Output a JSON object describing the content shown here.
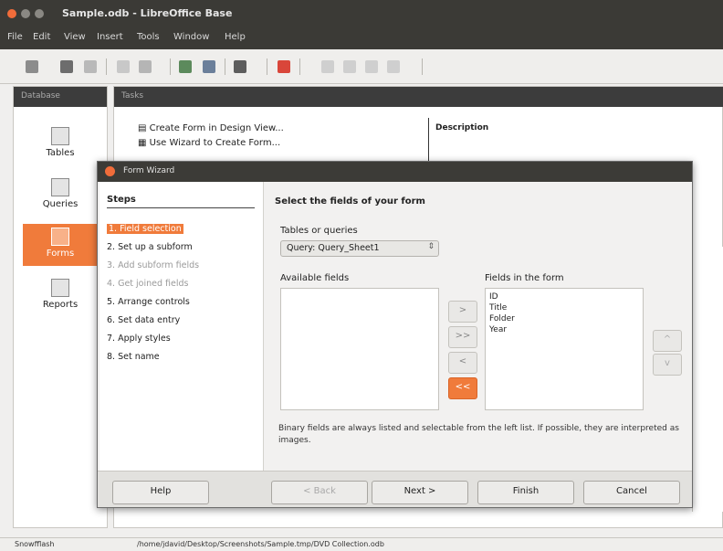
{
  "window": {
    "title": "Sample.odb - LibreOffice Base"
  },
  "menu": [
    "File",
    "Edit",
    "View",
    "Insert",
    "Tools",
    "Window",
    "Help"
  ],
  "database": {
    "header": "Database",
    "items": [
      {
        "label": "Tables"
      },
      {
        "label": "Queries"
      },
      {
        "label": "Forms"
      },
      {
        "label": "Reports"
      }
    ]
  },
  "tasks": {
    "header": "Tasks",
    "items": [
      "Create Form in Design View...",
      "Use Wizard to Create Form..."
    ],
    "description_label": "Description"
  },
  "status": {
    "left": "Snowfflash",
    "path": "/home/jdavid/Desktop/Screenshots/Sample.tmp/DVD Collection.odb"
  },
  "dialog": {
    "title": "Form Wizard",
    "steps_header": "Steps",
    "steps": [
      {
        "label": "1. Field selection",
        "state": "active"
      },
      {
        "label": "2. Set up a subform",
        "state": "normal"
      },
      {
        "label": "3. Add subform fields",
        "state": "disabled"
      },
      {
        "label": "4. Get joined fields",
        "state": "disabled"
      },
      {
        "label": "5. Arrange controls",
        "state": "normal"
      },
      {
        "label": "6. Set data entry",
        "state": "normal"
      },
      {
        "label": "7. Apply styles",
        "state": "normal"
      },
      {
        "label": "8. Set name",
        "state": "normal"
      }
    ],
    "pane_title": "Select the fields of your form",
    "tables_label": "Tables or queries",
    "tables_value": "Query: Query_Sheet1",
    "available_label": "Available fields",
    "available_fields": [],
    "inform_label": "Fields in the form",
    "inform_fields": [
      "ID",
      "Title",
      "Folder",
      "Year"
    ],
    "move_buttons": [
      ">",
      ">>",
      "<",
      "<<"
    ],
    "order_buttons": [
      "^",
      "v"
    ],
    "note": "Binary fields are always listed and selectable from the left list. If possible, they are interpreted as images.",
    "buttons": {
      "help": "Help",
      "back": "< Back",
      "next": "Next >",
      "finish": "Finish",
      "cancel": "Cancel"
    }
  },
  "colors": {
    "accent": "#f07b3b",
    "titlebar": "#3b3a36"
  }
}
